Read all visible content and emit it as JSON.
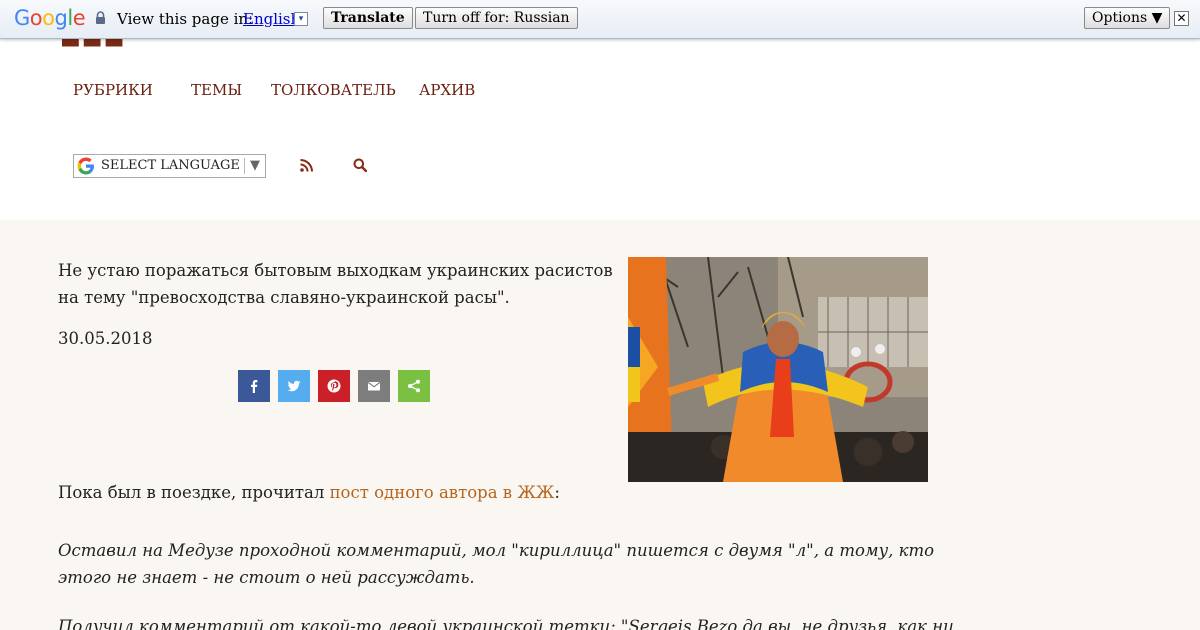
{
  "translate_bar": {
    "logo": "Google",
    "view_label": "View this page in:",
    "language": "English",
    "language_arrow": "▾",
    "translate_label": "Translate",
    "turn_off_label": "Turn off for: Russian",
    "options_label": "Options ▼",
    "close_label": "✕"
  },
  "header": {
    "nav": [
      "РУБРИКИ",
      "ТЕМЫ",
      "ТОЛКОВАТЕЛЬ",
      "АРХИВ"
    ],
    "language_select": "SELECT LANGUAGE",
    "language_select_arrow": "▼"
  },
  "article": {
    "intro": "Не устаю поражаться бытовым выходкам украинских расистов на тему \"превосходства славяно-украинской расы\".",
    "date": "30.05.2018",
    "share": [
      {
        "name": "facebook",
        "color": "#3b5998"
      },
      {
        "name": "twitter",
        "color": "#55acee"
      },
      {
        "name": "pinterest",
        "color": "#cb2027"
      },
      {
        "name": "email",
        "color": "#7d7d7d"
      },
      {
        "name": "share",
        "color": "#7ac143"
      }
    ],
    "p1_text": "Пока был в поездке, прочитал ",
    "p1_link": "пост одного автора в ЖЖ",
    "p1_end": ":",
    "quote": "Оставил на Медузе проходной комментарий, мол \"кириллица\" пишется с двумя \"л\", а тому, кто этого не знает - не стоит о ней рассуждать.",
    "quote2": "Получил комментарий от какой-то левой украинской тетки: \"Sergeis Bezo да вы, не друзья, как ни"
  }
}
